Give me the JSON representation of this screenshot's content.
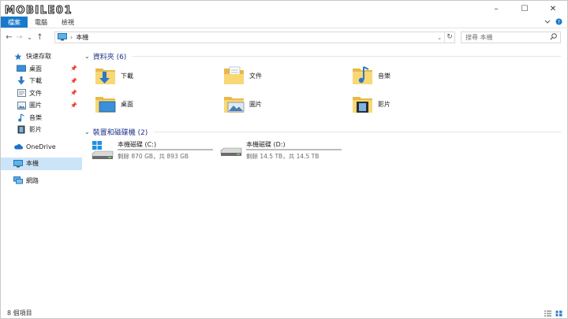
{
  "watermark": {
    "text": "MOBILE01"
  },
  "ribbon": {
    "tabs": [
      {
        "label": "檔案"
      },
      {
        "label": "電腦"
      },
      {
        "label": "檢視"
      }
    ]
  },
  "window_controls": {
    "minimize": "–",
    "maximize": "☐",
    "close": "✕"
  },
  "navbar": {
    "back": "←",
    "forward": "→",
    "recent": "⌄",
    "up": "↑",
    "breadcrumb": "本機",
    "refresh": "↻",
    "search_placeholder": "搜尋 本機"
  },
  "sidebar": {
    "items": [
      {
        "label": "快速存取",
        "icon": "star-icon"
      },
      {
        "label": "桌面",
        "icon": "desktop-icon",
        "pinned": true
      },
      {
        "label": "下載",
        "icon": "download-icon",
        "pinned": true
      },
      {
        "label": "文件",
        "icon": "documents-icon",
        "pinned": true
      },
      {
        "label": "圖片",
        "icon": "pictures-icon",
        "pinned": true
      },
      {
        "label": "音樂",
        "icon": "music-icon"
      },
      {
        "label": "影片",
        "icon": "videos-icon"
      },
      {
        "label": "OneDrive",
        "icon": "onedrive-icon"
      },
      {
        "label": "本機",
        "icon": "this-pc-icon",
        "selected": true
      },
      {
        "label": "網路",
        "icon": "network-icon"
      }
    ]
  },
  "folders": {
    "header": "資料夾 (6)",
    "items": [
      {
        "label": "下載",
        "icon": "downloads-folder-icon"
      },
      {
        "label": "文件",
        "icon": "documents-folder-icon"
      },
      {
        "label": "音樂",
        "icon": "music-folder-icon"
      },
      {
        "label": "桌面",
        "icon": "desktop-folder-icon"
      },
      {
        "label": "圖片",
        "icon": "pictures-folder-icon"
      },
      {
        "label": "影片",
        "icon": "videos-folder-icon"
      }
    ]
  },
  "drives": {
    "header": "裝置和磁碟機 (2)",
    "items": [
      {
        "label": "本機磁碟 (C:)",
        "size": "剩餘 870 GB，共 893 GB",
        "used_fraction": 0.026,
        "icon": "system-drive-icon"
      },
      {
        "label": "本機磁碟 (D:)",
        "size": "剩餘 14.5 TB，共 14.5 TB",
        "used_fraction": 0.0,
        "icon": "hard-drive-icon"
      }
    ]
  },
  "status": {
    "item_count": "8 個項目"
  },
  "colors": {
    "accent": "#1979ca",
    "header_text": "#1e3287",
    "selected_bg": "#cce4f7",
    "drive_bar": "#26a0da",
    "folder": "#f8d775"
  }
}
